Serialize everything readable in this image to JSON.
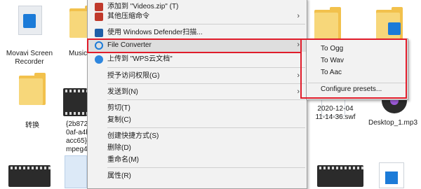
{
  "desktop_items": [
    {
      "id": "movavi",
      "label": "Movavi Screen\nRecorder"
    },
    {
      "id": "music",
      "label": "Music"
    },
    {
      "id": "zhuanhuan",
      "label": "转换"
    },
    {
      "id": "video_file",
      "label": "{2b872€\n0af-a4b\nacc65}_\nmpeg4"
    },
    {
      "id": "swf",
      "label": "2020-12-04\n11-14-36.swf"
    },
    {
      "id": "mp3",
      "label": "Desktop_1.mp3"
    }
  ],
  "context_menu": {
    "items": [
      {
        "label": "添加到 \"Videos.zip\" (T)",
        "icon": "archive-icon"
      },
      {
        "label": "其他压缩命令",
        "icon": "archive-icon",
        "submenu": true
      },
      {
        "label": "使用 Windows Defender扫描...",
        "icon": "shield-icon"
      },
      {
        "label": "File Converter",
        "icon": "file-converter-icon",
        "submenu": true
      },
      {
        "label": "上传到 \"WPS云文档\"",
        "icon": "cloud-icon"
      },
      {
        "label": "授予访问权限(G)",
        "submenu": true
      },
      {
        "label": "发送到(N)",
        "submenu": true
      },
      {
        "label": "剪切(T)"
      },
      {
        "label": "复制(C)"
      },
      {
        "label": "创建快捷方式(S)"
      },
      {
        "label": "删除(D)"
      },
      {
        "label": "重命名(M)"
      },
      {
        "label": "属性(R)"
      }
    ]
  },
  "submenu": {
    "items": [
      "To Ogg",
      "To Wav",
      "To Aac",
      "Configure presets..."
    ]
  },
  "colors": {
    "annotation_red": "#e01c2a",
    "menu_bg": "#f2f2f2",
    "folder": "#f2c14c",
    "accent_blue": "#1c7bd8"
  }
}
